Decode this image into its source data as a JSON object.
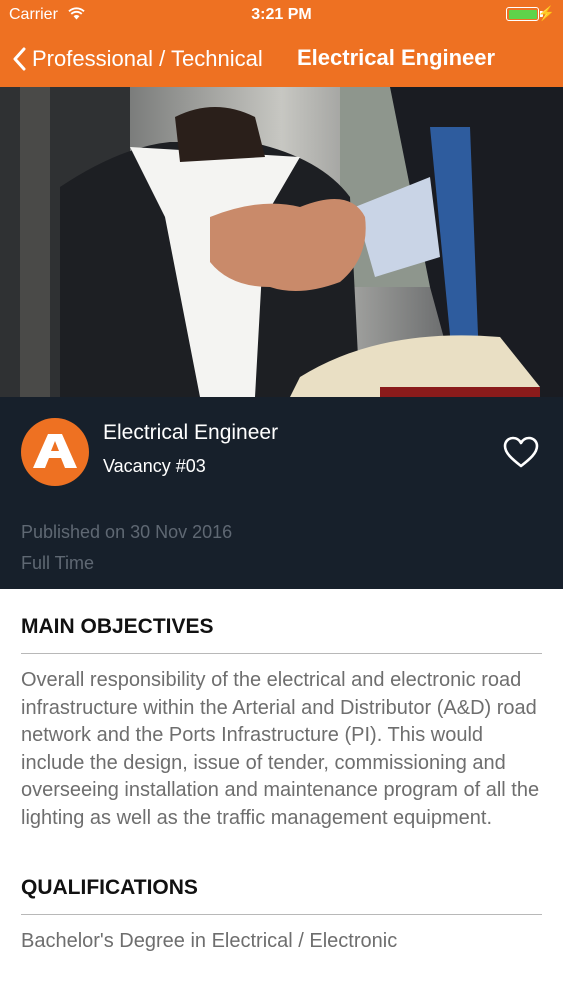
{
  "status_bar": {
    "carrier": "Carrier",
    "time": "3:21 PM",
    "battery_level": 1.0
  },
  "nav": {
    "back_label": "Professional / Technical",
    "title": "Electrical Engineer"
  },
  "job": {
    "title": "Electrical Engineer",
    "vacancy": "Vacancy #03",
    "published": "Published on 30 Nov 2016",
    "type": "Full Time"
  },
  "sections": [
    {
      "heading": "MAIN OBJECTIVES",
      "body": "Overall responsibility of the electrical and electronic road infrastructure within the Arterial and Distributor (A&D) road network and the Ports Infrastructure (PI). This would include the design, issue of tender, commissioning and overseeing installation and maintenance program of all the lighting as well as the traffic management equipment."
    },
    {
      "heading": "QUALIFICATIONS",
      "body": "Bachelor's Degree in Electrical / Electronic"
    }
  ],
  "colors": {
    "brand_orange": "#ee7122",
    "panel_dark": "#17202b",
    "muted_text": "#5f6873",
    "body_text": "#6e6e6e"
  },
  "icons": {
    "back": "chevron-left-icon",
    "favorite": "heart-outline-icon",
    "wifi": "wifi-icon",
    "battery": "battery-icon",
    "charging": "bolt-icon"
  }
}
